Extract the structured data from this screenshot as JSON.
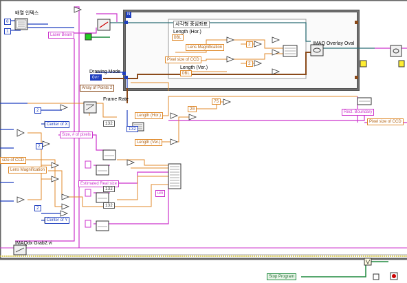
{
  "labels": {
    "array_index": "배열 인덱스",
    "loop_iter": "N",
    "loop_label": "사각형 중심좌표",
    "length_hor": "Length (Hor.)",
    "length_ver": "Length (Ver.)",
    "drawing_mode": "Drawing Mode",
    "frame_rate": "Frame Rate",
    "imaq_overlay": "IMAQ Overlay Oval",
    "imaq_grab": "IMAQdx Grab2.vi"
  },
  "controls": {
    "laser_beam": "Laser Beam",
    "lens_mag_1": "Lens Magnification",
    "pixel_ccd_1": "Pixel size of CCD",
    "array_points": "Array of Points 2",
    "center_x": "Center of X",
    "center_y": "Center of Y",
    "size_pixels": "Size, # of pixels",
    "size_ccd_2": "size of CCD",
    "lens_mag_2": "Lens Magnification",
    "estimated_real": "Estimated Real size",
    "length_hor_2": "Length (Hor.)",
    "length_ver_2": "Length (Ver.)",
    "rect_boundary": "Rect. Boundary",
    "pixel_ccd_2": "Pixel size of CCD",
    "stop_program": "Stop Program",
    "um_unit": "um"
  },
  "constants": {
    "c_0": "0",
    "c_1": "1",
    "c_2a": "2",
    "c_2b": "2",
    "c_2c": "2",
    "c_2d": "2",
    "c_2e": "2",
    "c_20": "20",
    "c_75": "75",
    "c_132a": "132",
    "c_132b": "132",
    "c_132c": "132",
    "dbl_1": "DBL",
    "dbl_2": "DBL",
    "i32": "I32",
    "mode_val": "Ovr"
  },
  "colors": {
    "pink": "#cc33cc",
    "orange": "#e08a2b",
    "blue": "#1f3fbf",
    "brown": "#8a4a1a",
    "green": "#1e8a3e"
  }
}
